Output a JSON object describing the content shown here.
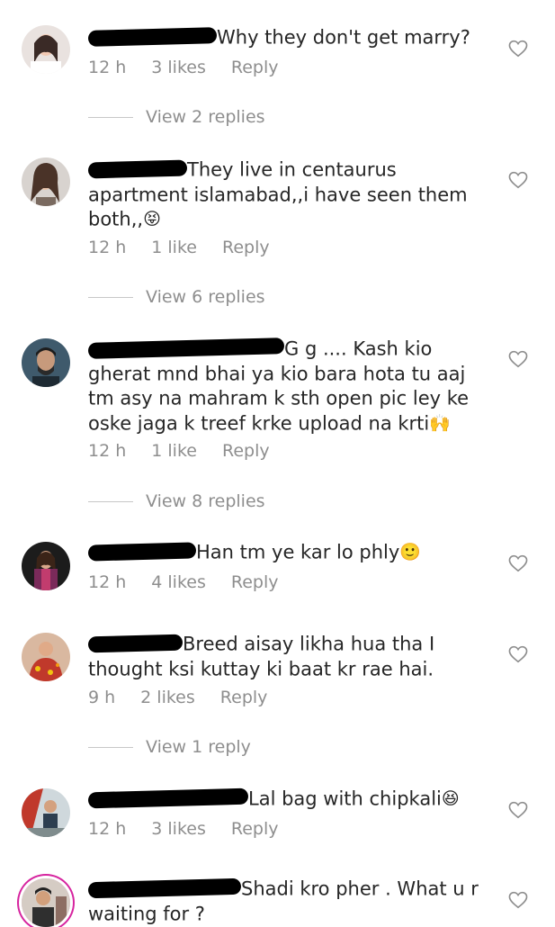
{
  "comments": [
    {
      "text": "Why they don't get marry?",
      "time": "12 h",
      "likes": "3 likes",
      "reply": "Reply",
      "view_replies": "View 2 replies",
      "emoji": ""
    },
    {
      "text": "They live in centaurus apartment islamabad,,i have seen them both,,",
      "time": "12 h",
      "likes": "1 like",
      "reply": "Reply",
      "view_replies": "View 6 replies",
      "emoji": "😝"
    },
    {
      "text": "G g .... Kash kio gherat mnd bhai ya kio bara hota tu aaj tm asy na mahram k sth open pic ley ke oske jaga k treef krke upload na krti",
      "time": "12 h",
      "likes": "1 like",
      "reply": "Reply",
      "view_replies": "View 8 replies",
      "emoji": "🙌"
    },
    {
      "text": "Han tm ye kar lo phly",
      "time": "12 h",
      "likes": "4 likes",
      "reply": "Reply",
      "view_replies": "",
      "emoji": "🙂"
    },
    {
      "text": "Breed aisay likha hua tha I thought ksi kuttay ki baat kr rae hai.",
      "time": "9 h",
      "likes": "2 likes",
      "reply": "Reply",
      "view_replies": "View 1 reply",
      "emoji": ""
    },
    {
      "text": "Lal bag with chipkali",
      "time": "12 h",
      "likes": "3 likes",
      "reply": "Reply",
      "view_replies": "",
      "emoji": "😆"
    },
    {
      "text": "Shadi kro pher . What u r waiting for ?",
      "time": "",
      "likes": "",
      "reply": "",
      "view_replies": "",
      "emoji": ""
    }
  ]
}
